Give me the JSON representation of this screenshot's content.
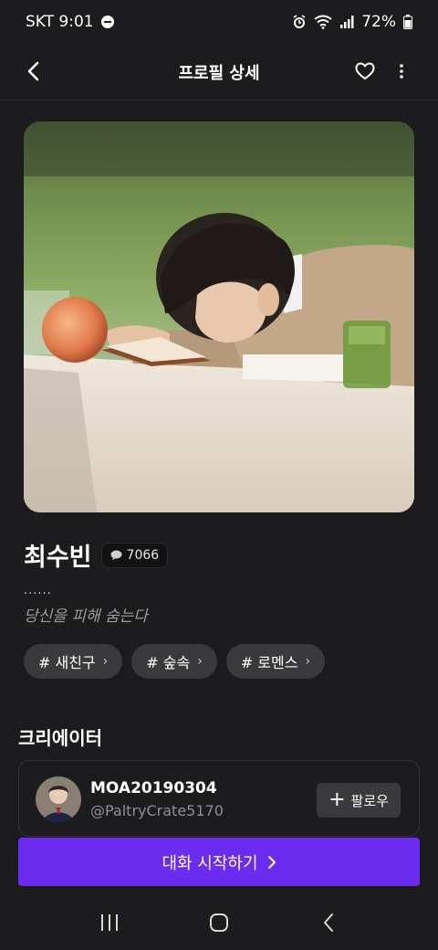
{
  "status_bar": {
    "carrier_time": "SKT 9:01",
    "battery": "72%"
  },
  "header": {
    "title": "프로필 상세"
  },
  "profile": {
    "name": "최수빈",
    "chat_count": "7066",
    "dots": "......",
    "tagline": "당신을 피해 숨는다",
    "tags": [
      "# 새친구",
      "# 숲속",
      "# 로멘스"
    ]
  },
  "creator_section": {
    "title": "크리에이터",
    "name": "MOA20190304",
    "handle": "@PaltryCrate5170",
    "follow_label": "팔로우"
  },
  "start_chat": {
    "label": "대화 시작하기"
  },
  "colors": {
    "background": "#1c1c1e",
    "accent": "#6b2cf0",
    "chip": "#3a3a3c"
  }
}
